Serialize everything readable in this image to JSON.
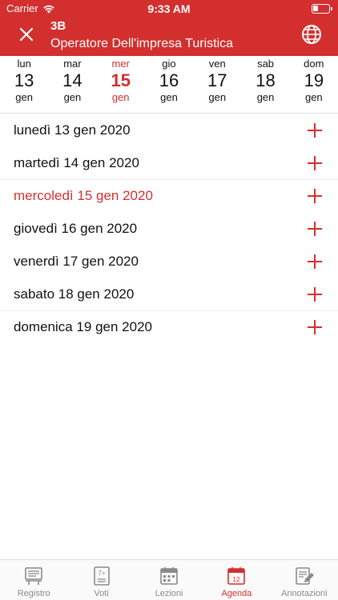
{
  "status": {
    "carrier": "Carrier",
    "time": "9:33 AM"
  },
  "header": {
    "class_name": "3B",
    "course": "Operatore Dell'impresa Turistica"
  },
  "week": [
    {
      "name": "lun",
      "num": "13",
      "month": "gen",
      "active": false
    },
    {
      "name": "mar",
      "num": "14",
      "month": "gen",
      "active": false
    },
    {
      "name": "mer",
      "num": "15",
      "month": "gen",
      "active": true
    },
    {
      "name": "gio",
      "num": "16",
      "month": "gen",
      "active": false
    },
    {
      "name": "ven",
      "num": "17",
      "month": "gen",
      "active": false
    },
    {
      "name": "sab",
      "num": "18",
      "month": "gen",
      "active": false
    },
    {
      "name": "dom",
      "num": "19",
      "month": "gen",
      "active": false
    }
  ],
  "days": [
    {
      "label": "lunedì 13 gen 2020"
    },
    {
      "label": "martedì 14 gen 2020"
    },
    {
      "label": "mercoledì 15 gen 2020"
    },
    {
      "label": "giovedì 16 gen 2020"
    },
    {
      "label": "venerdì 17 gen 2020"
    },
    {
      "label": "sabato 18 gen 2020"
    },
    {
      "label": "domenica 19 gen 2020"
    }
  ],
  "tabs": [
    {
      "label": "Registro",
      "icon": "register-icon",
      "active": false
    },
    {
      "label": "Voti",
      "icon": "grades-icon",
      "badge": "7+",
      "active": false
    },
    {
      "label": "Lezioni",
      "icon": "lessons-calendar-icon",
      "active": false
    },
    {
      "label": "Agenda",
      "icon": "agenda-calendar-icon",
      "badge": "12",
      "active": true
    },
    {
      "label": "Annotazioni",
      "icon": "notes-icon",
      "active": false
    }
  ],
  "colors": {
    "accent": "#d32f2f",
    "inactive": "#8a8a8a"
  }
}
